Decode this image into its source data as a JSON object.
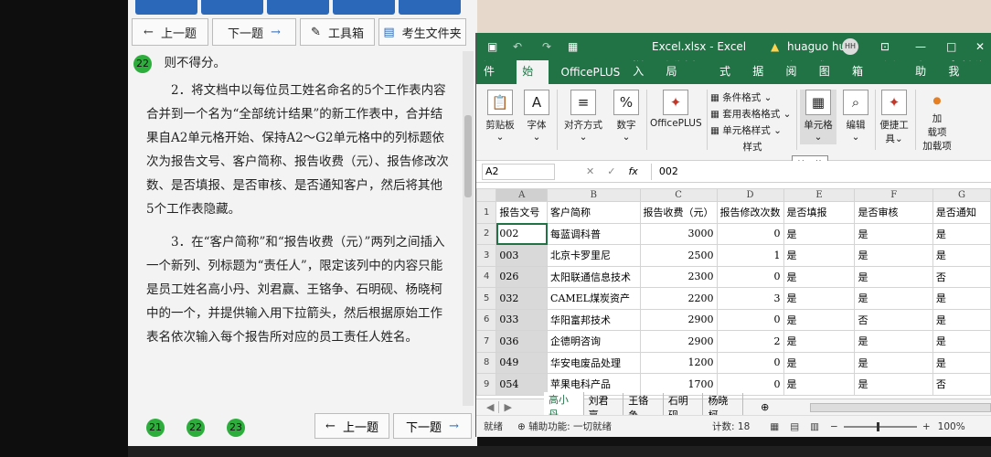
{
  "exam": {
    "prev_btn": "上一题",
    "next_btn": "下一题",
    "tools_btn": "工具箱",
    "folder_btn": "考生文件夹",
    "top_badge": "22",
    "line0": "则不得分。",
    "para2": "2．将文档中以每位员工姓名命名的5个工作表内容合并到一个名为“全部统计结果”的新工作表中，合并结果自A2单元格开始、保持A2～G2单元格中的列标题依次为报告文号、客户简称、报告收费（元）、报告修改次数、是否填报、是否审核、是否通知客户，然后将其他5个工作表隐藏。",
    "para3": "3．在“客户简称”和“报告收费（元）”两列之间插入一个新列、列标题为“责任人”，限定该列中的内容只能是员工姓名高小丹、刘君赢、王铬争、石明砚、杨晓柯中的一个，并提供输入用下拉箭头，然后根据原始工作表名依次输入每个报告所对应的员工责任人姓名。",
    "bottom_badges": [
      "21",
      "22",
      "23"
    ],
    "bottom_prev": "上一题",
    "bottom_next": "下一题"
  },
  "excel": {
    "filename": "Excel.xlsx  -  Excel",
    "user": "huaguo hu",
    "avatar": "HH",
    "menu": [
      "文件",
      "开始",
      "OfficePLUS",
      "插入",
      "页面布局",
      "公式",
      "数据",
      "审阅",
      "视图",
      "PDF工具箱",
      "帮助",
      "告诉我"
    ],
    "ribbon": {
      "clipboard": "剪贴板",
      "font": "字体",
      "align": "对齐方式",
      "number": "数字",
      "officeplus": "OfficePLUS",
      "cond_format": "条件格式",
      "table_format": "套用表格格式",
      "cell_style": "单元格样式",
      "styles": "样式",
      "cells": "单元格",
      "edit": "编辑",
      "tools1": "便捷工",
      "tools2": "具",
      "addin1": "加",
      "addin2": "载项",
      "addin_group": "加载项"
    },
    "tooltip": "单元格",
    "name_box": "A2",
    "formula": "002",
    "fx": "fx",
    "col_letters": [
      "A",
      "B",
      "C",
      "D",
      "E",
      "F",
      "G"
    ],
    "headers": [
      "报告文号",
      "客户简称",
      "报告收费（元）",
      "报告修改次数",
      "是否填报",
      "是否审核",
      "是否通知"
    ],
    "rows": [
      [
        "002",
        "每蓝调科普",
        "3000",
        "0",
        "是",
        "是",
        "是"
      ],
      [
        "003",
        "北京卡罗里尼",
        "2500",
        "1",
        "是",
        "是",
        "是"
      ],
      [
        "026",
        "太阳联通信息技术",
        "2300",
        "0",
        "是",
        "是",
        "否"
      ],
      [
        "032",
        "CAMEL煤炭资产",
        "2200",
        "3",
        "是",
        "是",
        "是"
      ],
      [
        "033",
        "华阳富邦技术",
        "2900",
        "0",
        "是",
        "否",
        "是"
      ],
      [
        "036",
        "企德明咨询",
        "2900",
        "2",
        "是",
        "是",
        "是"
      ],
      [
        "049",
        "华安电废品处理",
        "1200",
        "0",
        "是",
        "是",
        "是"
      ],
      [
        "054",
        "苹果电科产品",
        "1700",
        "0",
        "是",
        "是",
        "否"
      ]
    ],
    "sheet_tabs": [
      "高小丹",
      "刘君赢",
      "王铬争",
      "石明砚",
      "杨晓柯"
    ],
    "status_ready": "就绪",
    "status_access": "辅助功能: 一切就绪",
    "status_count": "计数: 18",
    "zoom": "100%"
  }
}
